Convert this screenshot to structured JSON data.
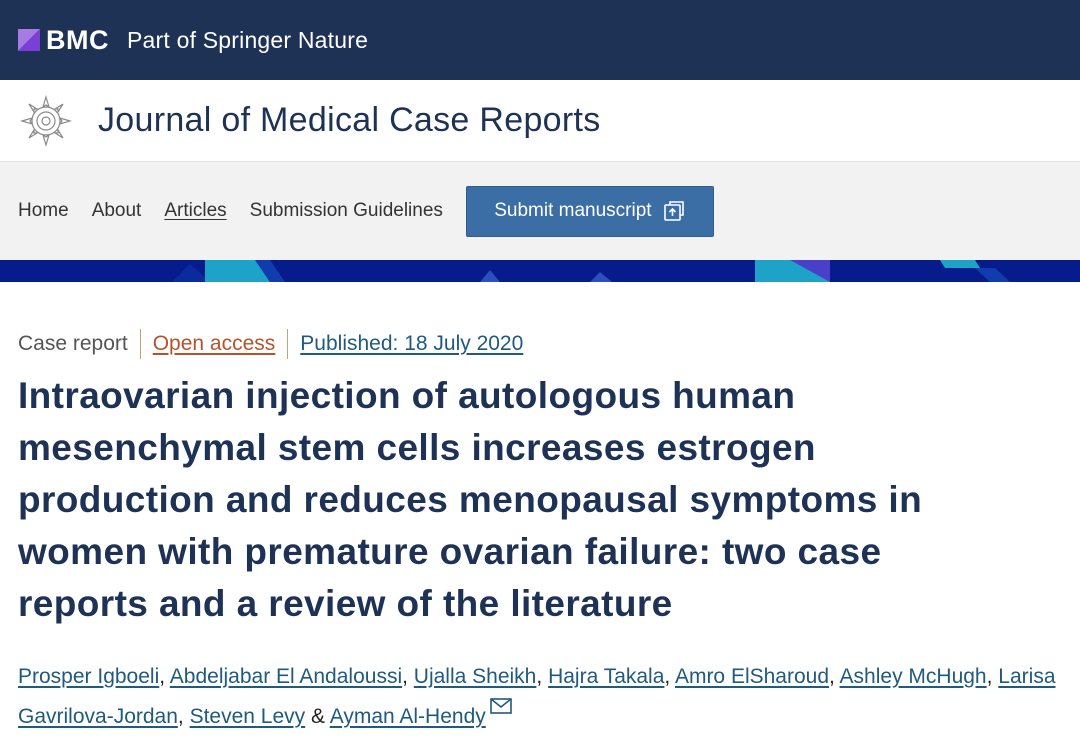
{
  "brand": {
    "logo_text": "BMC",
    "tagline": "Part of Springer Nature",
    "logo_mark_color": "#a77ae6"
  },
  "journal": {
    "title": "Journal of Medical Case Reports",
    "emblem_icon": "journal-emblem-icon"
  },
  "nav": {
    "items": [
      {
        "label": "Home"
      },
      {
        "label": "About"
      },
      {
        "label": "Articles"
      },
      {
        "label": "Submission Guidelines"
      }
    ],
    "active": "Articles",
    "submit_label": "Submit manuscript",
    "submit_icon": "external-link-icon"
  },
  "article": {
    "type": "Case report",
    "access": "Open access",
    "published": "Published: 18 July 2020",
    "title_lines": [
      "Intraovarian injection of autologous human",
      "mesenchymal stem cells increases estrogen",
      "production and reduces menopausal symptoms in",
      "women with premature ovarian failure: two case",
      "reports and a review of the literature"
    ],
    "authors": [
      "Prosper Igboeli",
      "Abdeljabar El Andaloussi",
      "Ujalla Sheikh",
      "Hajra Takala",
      "Amro ElSharoud",
      "Ashley McHugh",
      "Larisa Gavrilova-Jordan",
      "Steven Levy",
      "Ayman Al-Hendy"
    ],
    "author_separator": ",",
    "last_author_joiner": "&",
    "corresponding_icon": "mail-icon"
  },
  "colors": {
    "header_bg": "#1d3255",
    "nav_bg": "#f2f2f2",
    "button_bg": "#3a6ea5",
    "band_bg": "#061c8c",
    "band_accent": "#1ea3c8",
    "title_color": "#1d3255",
    "link_color": "#1f5a7f",
    "open_access_color": "#b5542c"
  }
}
